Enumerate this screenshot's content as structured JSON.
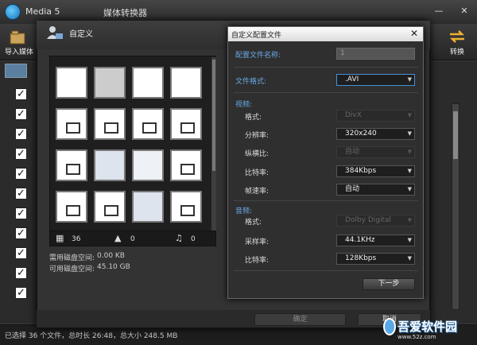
{
  "app": {
    "title": "Media 5",
    "subtitle": "媒体转换器",
    "import_label": "导入媒体",
    "convert_label": "转换",
    "header_watermark": "转换",
    "status": "已选择 36 个文件，总时长 26:48，总大小 248.5 MB"
  },
  "custom_dialog": {
    "title": "自定义",
    "stats": {
      "videos": "36",
      "images": "0",
      "audio": "0"
    },
    "disk_required_label": "需用磁盘空间:",
    "disk_required_value": "0.00 KB",
    "disk_available_label": "可用磁盘空间:",
    "disk_available_value": "45.10 GB",
    "ok_label": "确定",
    "cancel_label": "取消"
  },
  "profile_dialog": {
    "title": "自定义配置文件",
    "close_glyph": "✕",
    "name_label": "配置文件名称:",
    "name_value": "1",
    "format_label": "文件格式:",
    "format_value": ".AVI",
    "video_section": "视频:",
    "video_fields": [
      {
        "label": "格式:",
        "value": "DivX",
        "enabled": false
      },
      {
        "label": "分辨率:",
        "value": "320x240",
        "enabled": true
      },
      {
        "label": "纵横比:",
        "value": "自动",
        "enabled": false
      },
      {
        "label": "比特率:",
        "value": "384Kbps",
        "enabled": true
      },
      {
        "label": "帧速率:",
        "value": "自动",
        "enabled": true
      }
    ],
    "audio_section": "音频:",
    "audio_fields": [
      {
        "label": "格式:",
        "value": "Dolby Digital",
        "enabled": false
      },
      {
        "label": "采样率:",
        "value": "44.1KHz",
        "enabled": true
      },
      {
        "label": "比特率:",
        "value": "128Kbps",
        "enabled": true
      }
    ],
    "next_label": "下一步"
  },
  "watermark": {
    "title": "吾爱软件园",
    "url": "www.52z.com"
  },
  "colors": {
    "accent": "#6aa9e6",
    "background": "#333333"
  }
}
